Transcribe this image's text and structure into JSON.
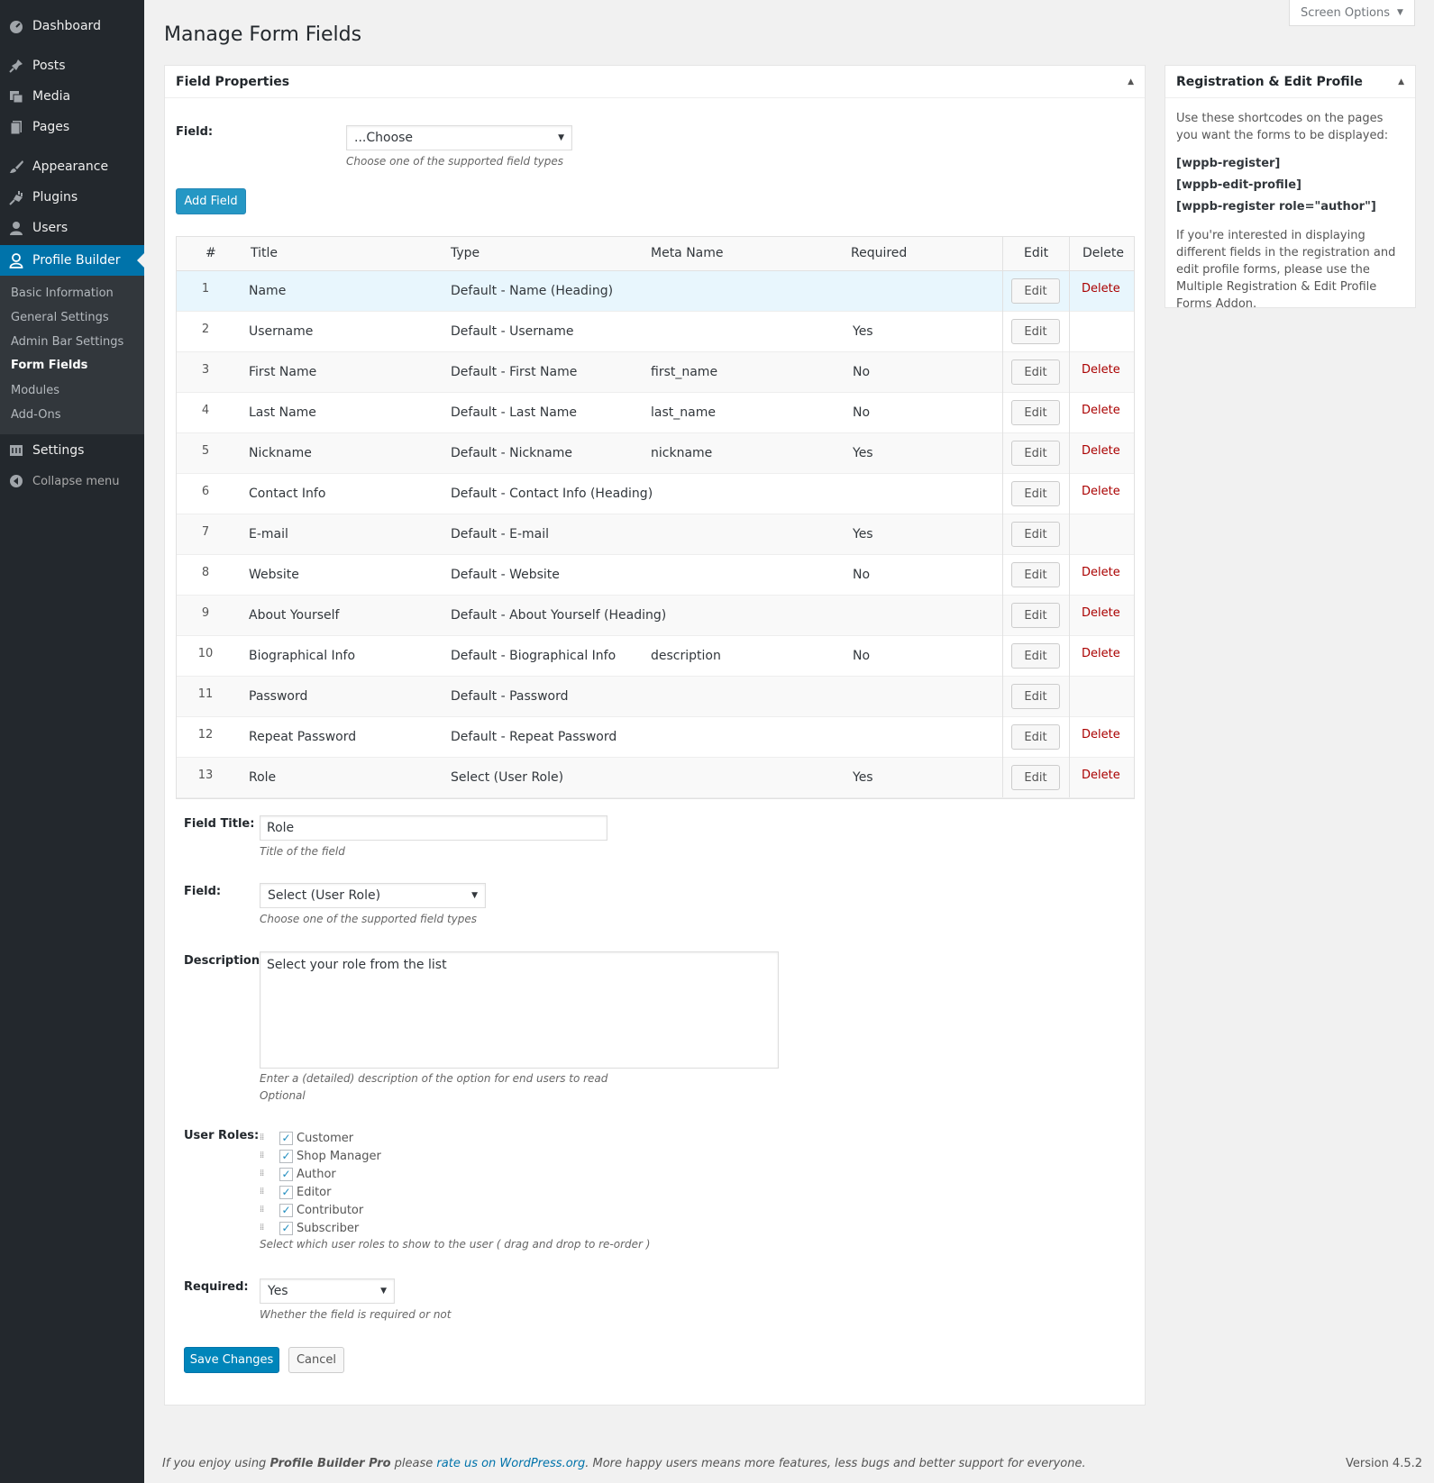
{
  "sidebar": {
    "items": [
      {
        "label": "Dashboard",
        "icon": "dashboard-icon"
      },
      {
        "label": "Posts",
        "icon": "pin-icon"
      },
      {
        "label": "Media",
        "icon": "media-icon"
      },
      {
        "label": "Pages",
        "icon": "pages-icon"
      },
      {
        "label": "Appearance",
        "icon": "brush-icon"
      },
      {
        "label": "Plugins",
        "icon": "plug-icon"
      },
      {
        "label": "Users",
        "icon": "users-icon"
      },
      {
        "label": "Profile Builder",
        "icon": "profile-icon"
      },
      {
        "label": "Settings",
        "icon": "settings-icon"
      }
    ],
    "submenu": [
      "Basic Information",
      "General Settings",
      "Admin Bar Settings",
      "Form Fields",
      "Modules",
      "Add-Ons"
    ],
    "collapse_label": "Collapse menu"
  },
  "header": {
    "screen_options": "Screen Options",
    "title": "Manage Form Fields"
  },
  "field_properties": {
    "heading": "Field Properties",
    "field_label": "Field:",
    "field_select_value": "...Choose",
    "field_desc": "Choose one of the supported field types",
    "add_button": "Add Field"
  },
  "table": {
    "headers": {
      "num": "#",
      "title": "Title",
      "type": "Type",
      "meta": "Meta Name",
      "required": "Required",
      "edit": "Edit",
      "delete": "Delete"
    },
    "edit_label": "Edit",
    "delete_label": "Delete",
    "rows": [
      {
        "num": "1",
        "title": "Name",
        "type": "Default - Name (Heading)",
        "meta": "",
        "required": "",
        "deletable": true
      },
      {
        "num": "2",
        "title": "Username",
        "type": "Default - Username",
        "meta": "",
        "required": "Yes",
        "deletable": false
      },
      {
        "num": "3",
        "title": "First Name",
        "type": "Default - First Name",
        "meta": "first_name",
        "required": "No",
        "deletable": true
      },
      {
        "num": "4",
        "title": "Last Name",
        "type": "Default - Last Name",
        "meta": "last_name",
        "required": "No",
        "deletable": true
      },
      {
        "num": "5",
        "title": "Nickname",
        "type": "Default - Nickname",
        "meta": "nickname",
        "required": "Yes",
        "deletable": true
      },
      {
        "num": "6",
        "title": "Contact Info",
        "type": "Default - Contact Info (Heading)",
        "meta": "",
        "required": "",
        "deletable": true
      },
      {
        "num": "7",
        "title": "E-mail",
        "type": "Default - E-mail",
        "meta": "",
        "required": "Yes",
        "deletable": false
      },
      {
        "num": "8",
        "title": "Website",
        "type": "Default - Website",
        "meta": "",
        "required": "No",
        "deletable": true
      },
      {
        "num": "9",
        "title": "About Yourself",
        "type": "Default - About Yourself (Heading)",
        "meta": "",
        "required": "",
        "deletable": true
      },
      {
        "num": "10",
        "title": "Biographical Info",
        "type": "Default - Biographical Info",
        "meta": "description",
        "required": "No",
        "deletable": true
      },
      {
        "num": "11",
        "title": "Password",
        "type": "Default - Password",
        "meta": "",
        "required": "",
        "deletable": false
      },
      {
        "num": "12",
        "title": "Repeat Password",
        "type": "Default - Repeat Password",
        "meta": "",
        "required": "",
        "deletable": true
      },
      {
        "num": "13",
        "title": "Role",
        "type": "Select (User Role)",
        "meta": "",
        "required": "Yes",
        "deletable": true
      }
    ]
  },
  "edit_form": {
    "title_label": "Field Title:",
    "title_value": "Role",
    "title_desc": "Title of the field",
    "field_label": "Field:",
    "field_value": "Select (User Role)",
    "field_desc": "Choose one of the supported field types",
    "description_label": "Description:",
    "description_value": "Select your role from the list",
    "description_desc1": "Enter a (detailed) description of the option for end users to read",
    "description_desc2": "Optional",
    "roles_label": "User Roles:",
    "roles": [
      "Customer",
      "Shop Manager",
      "Author",
      "Editor",
      "Contributor",
      "Subscriber"
    ],
    "roles_desc": "Select which user roles to show to the user ( drag and drop to re-order )",
    "required_label": "Required:",
    "required_value": "Yes",
    "required_desc": "Whether the field is required or not",
    "save_button": "Save Changes",
    "cancel_button": "Cancel"
  },
  "side_box": {
    "heading": "Registration & Edit Profile",
    "intro": "Use these shortcodes on the pages you want the forms to be displayed:",
    "shortcodes": [
      "[wppb-register]",
      "[wppb-edit-profile]",
      "[wppb-register role=\"author\"]"
    ],
    "note": "If you're interested in displaying different fields in the registration and edit profile forms, please use the Multiple Registration & Edit Profile Forms Addon."
  },
  "footer": {
    "left_1": "If you enjoy using ",
    "left_product": "Profile Builder Pro",
    "left_2": " please ",
    "left_link": "rate us on WordPress.org",
    "left_3": ". More happy users means more features, less bugs and better support for everyone.",
    "version": "Version 4.5.2"
  },
  "colors": {
    "admin_bar": "#23282d",
    "accent": "#0073aa",
    "delete": "#a00"
  }
}
